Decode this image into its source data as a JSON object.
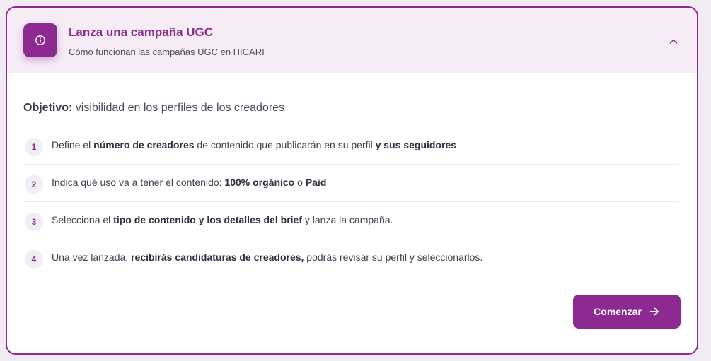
{
  "header": {
    "title": "Lanza una campaña UGC",
    "subtitle": "Cómo funcionan las campañas UGC en HICARI",
    "icon": "info-icon",
    "collapse_icon": "chevron-up-icon"
  },
  "objective": {
    "label": "Objetivo:",
    "text": " visibilidad en los perfiles de los creadores"
  },
  "steps": [
    {
      "number": "1",
      "parts": [
        {
          "t": "Define el ",
          "b": false
        },
        {
          "t": "número de creadores",
          "b": true
        },
        {
          "t": " de contenido que publicarán en su perfil ",
          "b": false
        },
        {
          "t": "y sus seguidores",
          "b": true
        }
      ]
    },
    {
      "number": "2",
      "parts": [
        {
          "t": "Indica qué uso va a tener el contenido: ",
          "b": false
        },
        {
          "t": "100% orgánico",
          "b": true
        },
        {
          "t": " o ",
          "b": false
        },
        {
          "t": "Paid",
          "b": true
        }
      ]
    },
    {
      "number": "3",
      "parts": [
        {
          "t": "Selecciona el ",
          "b": false
        },
        {
          "t": "tipo de contenido y los detalles del brief",
          "b": true
        },
        {
          "t": " y lanza la campaña.",
          "b": false
        }
      ]
    },
    {
      "number": "4",
      "parts": [
        {
          "t": "Una vez lanzada, ",
          "b": false
        },
        {
          "t": "recibirás candidaturas de creadores,",
          "b": true
        },
        {
          "t": " podrás revisar su perfil y seleccionarlos.",
          "b": false
        }
      ]
    }
  ],
  "start_button": {
    "label": "Comenzar",
    "icon": "arrow-right-icon"
  },
  "colors": {
    "accent": "#8c2a92",
    "header_bg": "#f5ecf6",
    "page_bg": "#f1ecf3"
  }
}
